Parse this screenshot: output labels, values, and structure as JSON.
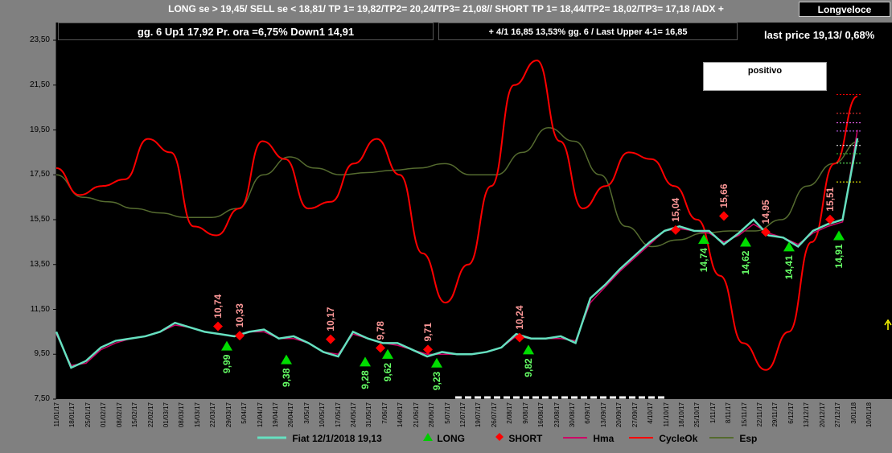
{
  "header": {
    "signal_text": "LONG se > 19,45/  SELL se < 18,81/ TP 1= 19,82/TP2= 20,24/TP3= 21,08//   SHORT TP 1= 18,44/TP2= 18,02/TP3= 17,18 /ADX +",
    "badge": "Longveloce",
    "box1": "gg. 6 Up1  17,92  Pr. ora =6,75%   Down1 14,91",
    "box2": "+  4/1   16,85  13,53%  gg. 6 / Last Upper 4-1= 16,85",
    "last_price": "last price 19,13/  0,68%",
    "status": "positivo"
  },
  "legend": [
    {
      "label": "Fiat  12/1/2018  19,13",
      "color": "#66e0c0"
    },
    {
      "label": "LONG",
      "color": "#00cc00"
    },
    {
      "label": "SHORT",
      "color": "#ff0000"
    },
    {
      "label": "Hma",
      "color": "#cc0066"
    },
    {
      "label": "CycleOk",
      "color": "#ff0000"
    },
    {
      "label": "Esp",
      "color": "#556b2f"
    }
  ],
  "chart_data": {
    "type": "line",
    "ylim": [
      7.5,
      23.5
    ],
    "yticks": [
      "23,50",
      "21,50",
      "19,50",
      "17,50",
      "15,50",
      "13,50",
      "11,50",
      "9,50",
      "7,50"
    ],
    "x_labels": [
      "11/01/17",
      "18/01/17",
      "25/01/17",
      "01/02/17",
      "08/02/17",
      "15/02/17",
      "22/02/17",
      "01/03/17",
      "08/03/17",
      "15/03/17",
      "22/03/17",
      "29/03/17",
      "5/04/17",
      "12/04/17",
      "19/04/17",
      "26/04/17",
      "3/05/17",
      "10/05/17",
      "17/05/17",
      "24/05/17",
      "31/05/17",
      "7/06/17",
      "14/06/17",
      "21/06/17",
      "28/06/17",
      "5/07/17",
      "12/07/17",
      "19/07/17",
      "26/07/17",
      "2/08/17",
      "9/08/17",
      "16/08/17",
      "23/08/17",
      "30/08/17",
      "6/09/17",
      "13/09/17",
      "20/09/17",
      "27/09/17",
      "4/10/17",
      "11/10/17",
      "18/10/17",
      "25/10/17",
      "1/11/17",
      "8/11/17",
      "15/11/17",
      "22/11/17",
      "29/11/17",
      "6/12/17",
      "13/12/17",
      "20/12/17",
      "27/12/17",
      "3/01/18",
      "10/01/18"
    ],
    "series": [
      {
        "name": "Fiat",
        "color": "#66e0c0",
        "values": [
          10.5,
          8.9,
          9.2,
          9.8,
          10.1,
          10.2,
          10.3,
          10.5,
          10.9,
          10.7,
          10.5,
          10.4,
          10.3,
          10.5,
          10.6,
          10.2,
          10.3,
          10.0,
          9.6,
          9.4,
          10.5,
          10.2,
          10.0,
          10.0,
          9.7,
          9.4,
          9.6,
          9.5,
          9.5,
          9.6,
          9.8,
          10.4,
          10.2,
          10.2,
          10.3,
          10.0,
          12.0,
          12.6,
          13.3,
          13.9,
          14.5,
          15.0,
          15.2,
          15.0,
          15.0,
          14.4,
          14.9,
          15.5,
          14.8,
          14.7,
          14.3,
          15.0,
          15.3,
          15.5,
          19.13
        ]
      },
      {
        "name": "Hma",
        "color": "#cc0066",
        "values": [
          10.4,
          9.0,
          9.1,
          9.7,
          10.0,
          10.2,
          10.3,
          10.5,
          10.8,
          10.7,
          10.5,
          10.4,
          10.3,
          10.5,
          10.5,
          10.2,
          10.2,
          10.0,
          9.6,
          9.5,
          10.4,
          10.2,
          10.0,
          9.9,
          9.7,
          9.5,
          9.5,
          9.5,
          9.5,
          9.6,
          9.8,
          10.3,
          10.2,
          10.2,
          10.2,
          10.1,
          11.8,
          12.5,
          13.2,
          13.8,
          14.4,
          15.0,
          15.1,
          15.0,
          14.9,
          14.5,
          14.8,
          15.3,
          14.9,
          14.7,
          14.4,
          14.9,
          15.2,
          15.4,
          19.5
        ]
      },
      {
        "name": "CycleOk",
        "color": "#ff0000",
        "values": [
          17.8,
          16.6,
          17.0,
          17.3,
          19.1,
          18.5,
          15.2,
          14.8,
          16.0,
          19.0,
          18.2,
          16.0,
          16.3,
          18.0,
          19.1,
          17.5,
          14.0,
          11.8,
          13.5,
          17.0,
          21.5,
          22.6,
          19.0,
          16.0,
          17.0,
          18.5,
          18.2,
          17.0,
          15.5,
          13.0,
          10.0,
          8.8,
          10.5,
          14.5,
          18.0,
          21.0
        ]
      },
      {
        "name": "Esp",
        "color": "#556b2f",
        "values": [
          17.5,
          16.5,
          16.3,
          16.0,
          15.8,
          15.6,
          15.6,
          16.0,
          17.5,
          18.3,
          17.8,
          17.5,
          17.6,
          17.7,
          17.8,
          18.0,
          17.5,
          17.5,
          18.5,
          19.6,
          19.0,
          17.5,
          15.2,
          14.3,
          14.6,
          14.9,
          15.0,
          15.0,
          15.5,
          17.0,
          18.0,
          19.0
        ]
      }
    ],
    "long_signals": [
      {
        "label": "9,99",
        "value": 9.99
      },
      {
        "label": "9,38",
        "value": 9.38
      },
      {
        "label": "9,28",
        "value": 9.28
      },
      {
        "label": "9,62",
        "value": 9.62
      },
      {
        "label": "9,23",
        "value": 9.23
      },
      {
        "label": "9,82",
        "value": 9.82
      },
      {
        "label": "14,74",
        "value": 14.74
      },
      {
        "label": "14,62",
        "value": 14.62
      },
      {
        "label": "14,41",
        "value": 14.41
      },
      {
        "label": "14,91",
        "value": 14.91
      }
    ],
    "short_signals": [
      {
        "label": "10,74",
        "value": 10.74
      },
      {
        "label": "10,33",
        "value": 10.33
      },
      {
        "label": "10,17",
        "value": 10.17
      },
      {
        "label": "9,78",
        "value": 9.78
      },
      {
        "label": "9,71",
        "value": 9.71
      },
      {
        "label": "10,24",
        "value": 10.24
      },
      {
        "label": "15,04",
        "value": 15.04
      },
      {
        "label": "15,66",
        "value": 15.66
      },
      {
        "label": "14,95",
        "value": 14.95
      },
      {
        "label": "15,51",
        "value": 15.51
      }
    ],
    "target_levels": [
      21.08,
      20.24,
      19.82,
      19.45,
      18.81,
      18.44,
      18.02,
      17.18
    ]
  }
}
